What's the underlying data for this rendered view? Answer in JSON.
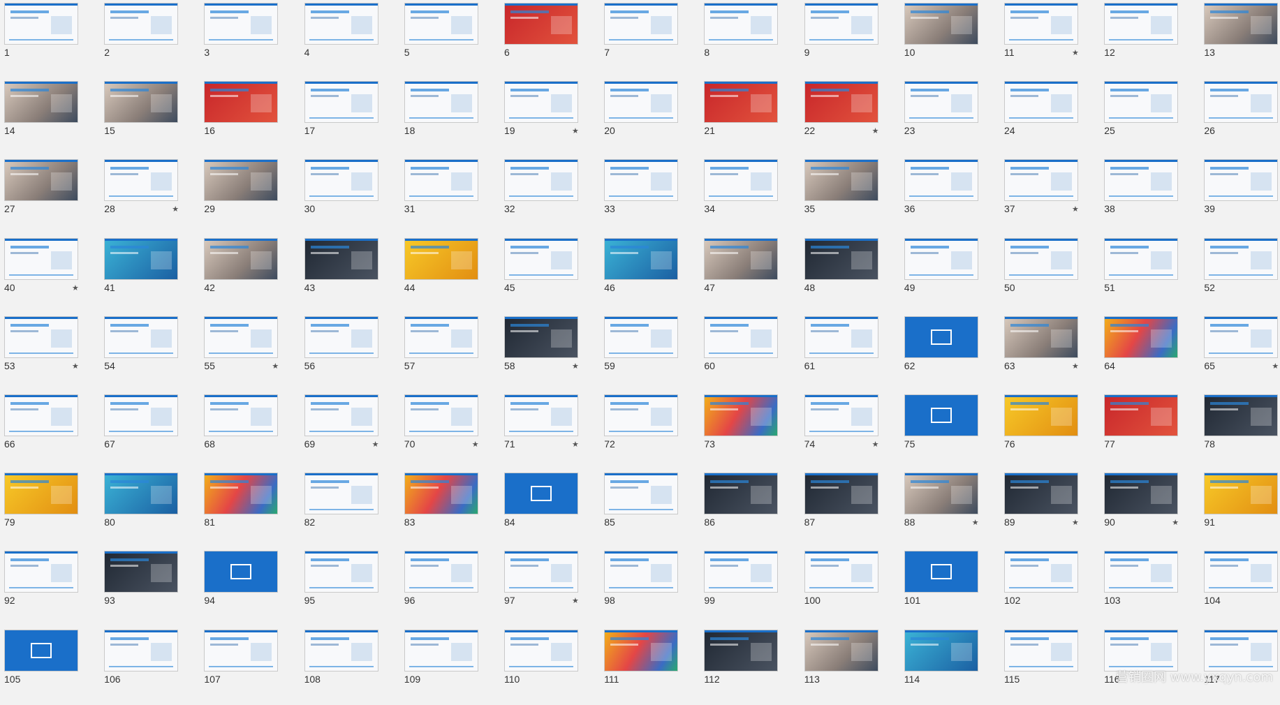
{
  "view": "slide-sorter",
  "slides": [
    {
      "n": "1",
      "star": false,
      "style": "light"
    },
    {
      "n": "2",
      "star": false,
      "style": "light"
    },
    {
      "n": "3",
      "star": false,
      "style": "light"
    },
    {
      "n": "4",
      "star": false,
      "style": "light"
    },
    {
      "n": "5",
      "star": false,
      "style": "light"
    },
    {
      "n": "6",
      "star": false,
      "style": "red"
    },
    {
      "n": "7",
      "star": false,
      "style": "light"
    },
    {
      "n": "8",
      "star": false,
      "style": "light"
    },
    {
      "n": "9",
      "star": false,
      "style": "light"
    },
    {
      "n": "10",
      "star": false,
      "style": "photo"
    },
    {
      "n": "11",
      "star": true,
      "style": "light"
    },
    {
      "n": "12",
      "star": false,
      "style": "light"
    },
    {
      "n": "13",
      "star": false,
      "style": "photo"
    },
    {
      "n": "14",
      "star": false,
      "style": "photo"
    },
    {
      "n": "15",
      "star": false,
      "style": "photo"
    },
    {
      "n": "16",
      "star": false,
      "style": "red"
    },
    {
      "n": "17",
      "star": false,
      "style": "light"
    },
    {
      "n": "18",
      "star": false,
      "style": "light"
    },
    {
      "n": "19",
      "star": true,
      "style": "light"
    },
    {
      "n": "20",
      "star": false,
      "style": "light"
    },
    {
      "n": "21",
      "star": false,
      "style": "red"
    },
    {
      "n": "22",
      "star": true,
      "style": "red"
    },
    {
      "n": "23",
      "star": false,
      "style": "light"
    },
    {
      "n": "24",
      "star": false,
      "style": "light"
    },
    {
      "n": "25",
      "star": false,
      "style": "light"
    },
    {
      "n": "26",
      "star": false,
      "style": "light"
    },
    {
      "n": "27",
      "star": false,
      "style": "photo"
    },
    {
      "n": "28",
      "star": true,
      "style": "light"
    },
    {
      "n": "29",
      "star": false,
      "style": "photo"
    },
    {
      "n": "30",
      "star": false,
      "style": "light"
    },
    {
      "n": "31",
      "star": false,
      "style": "light"
    },
    {
      "n": "32",
      "star": false,
      "style": "light"
    },
    {
      "n": "33",
      "star": false,
      "style": "light"
    },
    {
      "n": "34",
      "star": false,
      "style": "light"
    },
    {
      "n": "35",
      "star": false,
      "style": "photo"
    },
    {
      "n": "36",
      "star": false,
      "style": "light"
    },
    {
      "n": "37",
      "star": true,
      "style": "light"
    },
    {
      "n": "38",
      "star": false,
      "style": "light"
    },
    {
      "n": "39",
      "star": false,
      "style": "light"
    },
    {
      "n": "40",
      "star": true,
      "style": "light"
    },
    {
      "n": "41",
      "star": false,
      "style": "teal"
    },
    {
      "n": "42",
      "star": false,
      "style": "photo"
    },
    {
      "n": "43",
      "star": false,
      "style": "dark"
    },
    {
      "n": "44",
      "star": false,
      "style": "yellow"
    },
    {
      "n": "45",
      "star": false,
      "style": "light"
    },
    {
      "n": "46",
      "star": false,
      "style": "teal"
    },
    {
      "n": "47",
      "star": false,
      "style": "photo"
    },
    {
      "n": "48",
      "star": false,
      "style": "dark"
    },
    {
      "n": "49",
      "star": false,
      "style": "light"
    },
    {
      "n": "50",
      "star": false,
      "style": "light"
    },
    {
      "n": "51",
      "star": false,
      "style": "light"
    },
    {
      "n": "52",
      "star": false,
      "style": "light"
    },
    {
      "n": "53",
      "star": true,
      "style": "light"
    },
    {
      "n": "54",
      "star": false,
      "style": "light"
    },
    {
      "n": "55",
      "star": true,
      "style": "light"
    },
    {
      "n": "56",
      "star": false,
      "style": "light"
    },
    {
      "n": "57",
      "star": false,
      "style": "light"
    },
    {
      "n": "58",
      "star": true,
      "style": "dark"
    },
    {
      "n": "59",
      "star": false,
      "style": "light"
    },
    {
      "n": "60",
      "star": false,
      "style": "light"
    },
    {
      "n": "61",
      "star": false,
      "style": "light"
    },
    {
      "n": "62",
      "star": false,
      "style": "blue"
    },
    {
      "n": "63",
      "star": true,
      "style": "photo"
    },
    {
      "n": "64",
      "star": false,
      "style": "colorful"
    },
    {
      "n": "65",
      "star": true,
      "style": "light"
    },
    {
      "n": "66",
      "star": false,
      "style": "light"
    },
    {
      "n": "67",
      "star": false,
      "style": "light"
    },
    {
      "n": "68",
      "star": false,
      "style": "light"
    },
    {
      "n": "69",
      "star": true,
      "style": "light"
    },
    {
      "n": "70",
      "star": true,
      "style": "light"
    },
    {
      "n": "71",
      "star": true,
      "style": "light"
    },
    {
      "n": "72",
      "star": false,
      "style": "light"
    },
    {
      "n": "73",
      "star": false,
      "style": "colorful"
    },
    {
      "n": "74",
      "star": true,
      "style": "light"
    },
    {
      "n": "75",
      "star": false,
      "style": "blue"
    },
    {
      "n": "76",
      "star": false,
      "style": "yellow"
    },
    {
      "n": "77",
      "star": false,
      "style": "red"
    },
    {
      "n": "78",
      "star": false,
      "style": "dark"
    },
    {
      "n": "79",
      "star": false,
      "style": "yellow"
    },
    {
      "n": "80",
      "star": false,
      "style": "teal"
    },
    {
      "n": "81",
      "star": false,
      "style": "colorful"
    },
    {
      "n": "82",
      "star": false,
      "style": "light"
    },
    {
      "n": "83",
      "star": false,
      "style": "colorful"
    },
    {
      "n": "84",
      "star": false,
      "style": "blue"
    },
    {
      "n": "85",
      "star": false,
      "style": "light"
    },
    {
      "n": "86",
      "star": false,
      "style": "dark"
    },
    {
      "n": "87",
      "star": false,
      "style": "dark"
    },
    {
      "n": "88",
      "star": true,
      "style": "photo"
    },
    {
      "n": "89",
      "star": true,
      "style": "dark"
    },
    {
      "n": "90",
      "star": true,
      "style": "dark"
    },
    {
      "n": "91",
      "star": false,
      "style": "yellow"
    },
    {
      "n": "92",
      "star": false,
      "style": "light"
    },
    {
      "n": "93",
      "star": false,
      "style": "dark"
    },
    {
      "n": "94",
      "star": false,
      "style": "blue"
    },
    {
      "n": "95",
      "star": false,
      "style": "light"
    },
    {
      "n": "96",
      "star": false,
      "style": "light"
    },
    {
      "n": "97",
      "star": true,
      "style": "light"
    },
    {
      "n": "98",
      "star": false,
      "style": "light"
    },
    {
      "n": "99",
      "star": false,
      "style": "light"
    },
    {
      "n": "100",
      "star": false,
      "style": "light"
    },
    {
      "n": "101",
      "star": false,
      "style": "blue"
    },
    {
      "n": "102",
      "star": false,
      "style": "light"
    },
    {
      "n": "103",
      "star": false,
      "style": "light"
    },
    {
      "n": "104",
      "star": false,
      "style": "light"
    },
    {
      "n": "105",
      "star": false,
      "style": "blue"
    },
    {
      "n": "106",
      "star": false,
      "style": "light"
    },
    {
      "n": "107",
      "star": false,
      "style": "light"
    },
    {
      "n": "108",
      "star": false,
      "style": "light"
    },
    {
      "n": "109",
      "star": false,
      "style": "light"
    },
    {
      "n": "110",
      "star": false,
      "style": "light"
    },
    {
      "n": "111",
      "star": false,
      "style": "colorful"
    },
    {
      "n": "112",
      "star": false,
      "style": "dark"
    },
    {
      "n": "113",
      "star": false,
      "style": "photo"
    },
    {
      "n": "114",
      "star": false,
      "style": "teal"
    },
    {
      "n": "115",
      "star": false,
      "style": "light"
    },
    {
      "n": "116",
      "star": false,
      "style": "light"
    },
    {
      "n": "117",
      "star": false,
      "style": "light"
    }
  ],
  "star_glyph": "★",
  "watermark": "营销圈网 www.yxqyn.com",
  "colors": {
    "accent": "#1a6fc9",
    "background": "#f2f2f2"
  }
}
